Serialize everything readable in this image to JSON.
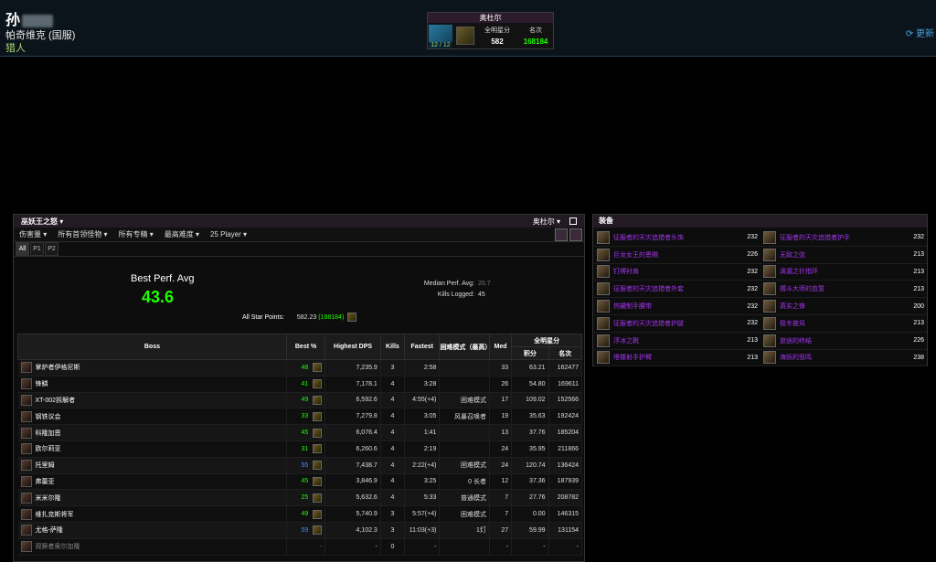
{
  "header": {
    "char_name": "孙",
    "server": "帕奇维克 (国服)",
    "class": "猎人",
    "update_label": "更新",
    "raid": {
      "title": "奥杜尔",
      "progress": "12 / 12",
      "allstar_label": "全明星分",
      "allstar_value": "582",
      "rank_label": "名次",
      "rank_value": "168184"
    }
  },
  "main": {
    "zone": "巫妖王之怒",
    "zone_right": "奥杜尔",
    "filters": [
      "伤害量",
      "所有首领怪物",
      "所有专精",
      "最高难度",
      "25 Player"
    ],
    "tabs": [
      "All",
      "P1",
      "P2"
    ],
    "best_perf_label": "Best Perf. Avg",
    "best_perf_value": "43.6",
    "median_label": "Median Perf. Avg:",
    "median_value": "20.7",
    "kills_label": "Kills Logged:",
    "kills_value": "45",
    "allstar_label": "All Star Points:",
    "allstar_value": "582.23",
    "allstar_rank": "(168184)"
  },
  "table": {
    "headers": {
      "boss": "Boss",
      "best": "Best %",
      "dps": "Highest DPS",
      "kills": "Kills",
      "fastest": "Fastest",
      "mode": "困难模式（最高）",
      "med": "Med",
      "allstar": "全明星分",
      "points": "积分",
      "rank": "名次"
    },
    "rows": [
      {
        "boss": "掌炉者伊格尼斯",
        "best": "48",
        "best_color": "c-green",
        "dps": "7,235.9",
        "kills": "3",
        "fastest": "2:58",
        "mode": "",
        "med": "33",
        "med_color": "c-green",
        "points": "63.21",
        "rank": "162477",
        "rank_color": "c-green"
      },
      {
        "boss": "锋鳞",
        "best": "41",
        "best_color": "c-green",
        "dps": "7,178.1",
        "kills": "4",
        "fastest": "3:28",
        "mode": "",
        "med": "26",
        "med_color": "c-green",
        "points": "54.80",
        "rank": "169611",
        "rank_color": "c-green"
      },
      {
        "boss": "XT-002拆解者",
        "best": "49",
        "best_color": "c-green",
        "dps": "6,592.6",
        "kills": "4",
        "fastest": "4:55(+4)",
        "mode": "困难模式",
        "med": "17",
        "med_color": "c-grey",
        "points": "109.02",
        "rank": "152566",
        "rank_color": "c-green"
      },
      {
        "boss": "钢铁议会",
        "best": "33",
        "best_color": "c-green",
        "dps": "7,279.8",
        "kills": "4",
        "fastest": "3:05",
        "mode": "风暴召唤者",
        "med": "19",
        "med_color": "c-grey",
        "points": "35.63",
        "rank": "192424",
        "rank_color": "c-green"
      },
      {
        "boss": "科隆加恩",
        "best": "45",
        "best_color": "c-green",
        "dps": "6,076.4",
        "kills": "4",
        "fastest": "1:41",
        "mode": "",
        "med": "13",
        "med_color": "c-grey",
        "points": "37.76",
        "rank": "185204",
        "rank_color": "c-green"
      },
      {
        "boss": "欧尔莉亚",
        "best": "31",
        "best_color": "c-green",
        "dps": "6,260.6",
        "kills": "4",
        "fastest": "2:19",
        "mode": "",
        "med": "24",
        "med_color": "c-grey",
        "points": "35.95",
        "rank": "211866",
        "rank_color": "c-grey"
      },
      {
        "boss": "托里姆",
        "best": "55",
        "best_color": "c-blue",
        "dps": "7,438.7",
        "kills": "4",
        "fastest": "2:22(+4)",
        "mode": "困难模式",
        "med": "24",
        "med_color": "c-grey",
        "points": "120.74",
        "rank": "136424",
        "rank_color": "c-green"
      },
      {
        "boss": "弗蕾亚",
        "best": "45",
        "best_color": "c-green",
        "dps": "3,846.9",
        "kills": "4",
        "fastest": "3:25",
        "mode": "0 长者",
        "med": "12",
        "med_color": "c-grey",
        "points": "37.36",
        "rank": "187939",
        "rank_color": "c-green"
      },
      {
        "boss": "米米尔隆",
        "best": "25",
        "best_color": "c-green",
        "dps": "5,632.6",
        "kills": "4",
        "fastest": "5:33",
        "mode": "普通模式",
        "med": "7",
        "med_color": "c-grey",
        "points": "27.76",
        "rank": "208782",
        "rank_color": "c-grey"
      },
      {
        "boss": "维扎克斯将军",
        "best": "49",
        "best_color": "c-green",
        "dps": "5,740.9",
        "kills": "3",
        "fastest": "5:57(+4)",
        "mode": "困难模式",
        "med": "7",
        "med_color": "c-grey",
        "points": "0.00",
        "rank": "146315",
        "rank_color": "c-green"
      },
      {
        "boss": "尤格-萨隆",
        "best": "59",
        "best_color": "c-blue",
        "dps": "4,102.3",
        "kills": "3",
        "fastest": "11:03(+3)",
        "mode": "1灯",
        "med": "27",
        "med_color": "c-green",
        "points": "59.99",
        "rank": "131154",
        "rank_color": "c-green"
      },
      {
        "boss": "观察者奥尔加隆",
        "best": "-",
        "best_color": "c-grey",
        "dps": "-",
        "kills": "0",
        "fastest": "-",
        "mode": "",
        "med": "-",
        "med_color": "c-grey",
        "points": "-",
        "rank": "-",
        "rank_color": "c-grey"
      }
    ]
  },
  "gear": {
    "title": "装备",
    "items": [
      {
        "name": "征服者的天灾追猎者头饰",
        "level": "232"
      },
      {
        "name": "征服者的天灾追猎者护手",
        "level": "232"
      },
      {
        "name": "巨龙女王的恩赐",
        "level": "226"
      },
      {
        "name": "无敌之弦",
        "level": "213"
      },
      {
        "name": "钉缚衬肩",
        "level": "232"
      },
      {
        "name": "滴漏之针指环",
        "level": "213"
      },
      {
        "name": "征服者的天灾追猎者外套",
        "level": "232"
      },
      {
        "name": "搏斗大师的血誓",
        "level": "213"
      },
      {
        "name": "热罐制手腰带",
        "level": "232"
      },
      {
        "name": "真实之锋",
        "level": "200"
      },
      {
        "name": "征服者的天灾追猎者护腿",
        "level": "232"
      },
      {
        "name": "极冬披风",
        "level": "213"
      },
      {
        "name": "浮冰之靴",
        "level": "213"
      },
      {
        "name": "旅途的终结",
        "level": "226"
      },
      {
        "name": "塔楼射手护臂",
        "level": "213"
      },
      {
        "name": "海妖的悲鸣",
        "level": "238"
      }
    ]
  }
}
